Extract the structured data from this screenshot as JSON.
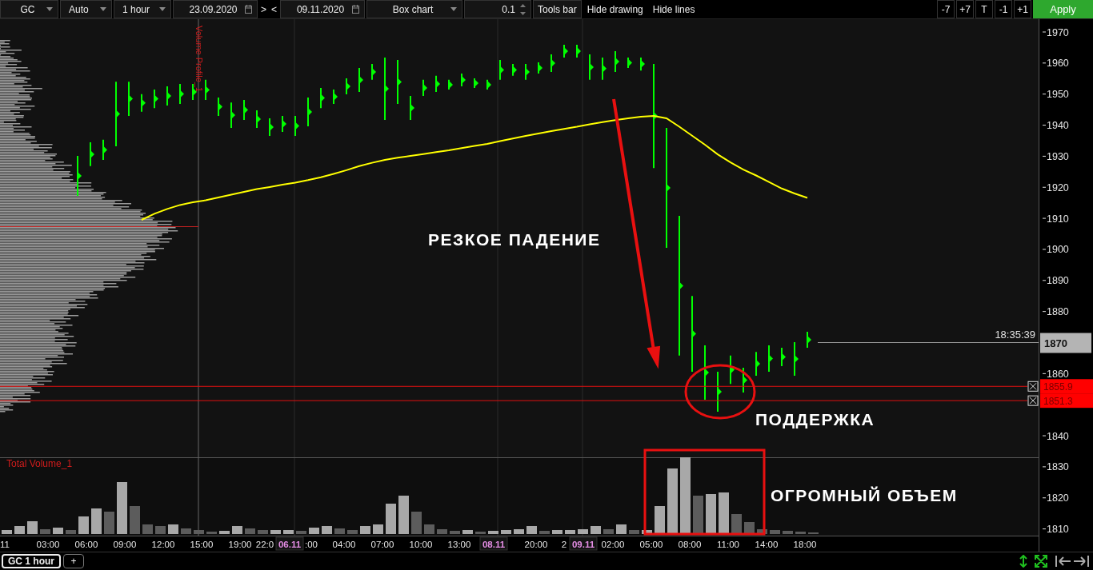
{
  "toolbar": {
    "symbol": "GC",
    "scale": "Auto",
    "timeframe": "1 hour",
    "date_from": "23.09.2020",
    "step_forward": ">",
    "step_back": "<",
    "date_to": "09.11.2020",
    "chart_type": "Box chart",
    "tick_size": "0.1",
    "buttons": [
      "Tools bar",
      "Hide drawing",
      "Hide lines"
    ],
    "shift_buttons": [
      "-7",
      "+7",
      "T",
      "-1",
      "+1"
    ],
    "apply": "Apply"
  },
  "price_pane": {
    "indicator": "Volume Profile_1",
    "price_axis": [
      "1970",
      "1960",
      "1950",
      "1940",
      "1930",
      "1920",
      "1910",
      "1900",
      "1890",
      "1880",
      "1860",
      "1840",
      "1830",
      "1820",
      "1810"
    ],
    "price_markers": [
      {
        "kind": "last",
        "label": "1870",
        "time": "18:35:39"
      },
      {
        "kind": "level",
        "label": "1855.9"
      },
      {
        "kind": "level",
        "label": "1851.3"
      }
    ]
  },
  "volume_pane": {
    "indicator": "Total Volume_1"
  },
  "time_axis": [
    {
      "label": "11",
      "kind": "time"
    },
    {
      "label": "03:00",
      "kind": "time"
    },
    {
      "label": "06:00",
      "kind": "time"
    },
    {
      "label": "09:00",
      "kind": "time"
    },
    {
      "label": "12:00",
      "kind": "time"
    },
    {
      "label": "15:00",
      "kind": "time"
    },
    {
      "label": "19:00",
      "kind": "time"
    },
    {
      "label": "22:0",
      "kind": "time"
    },
    {
      "label": "06.11",
      "kind": "date"
    },
    {
      "label": ":00",
      "kind": "time"
    },
    {
      "label": "04:00",
      "kind": "time"
    },
    {
      "label": "07:00",
      "kind": "time"
    },
    {
      "label": "10:00",
      "kind": "time"
    },
    {
      "label": "13:00",
      "kind": "time"
    },
    {
      "label": "08.11",
      "kind": "date"
    },
    {
      "label": "20:00",
      "kind": "time"
    },
    {
      "label": "2",
      "kind": "time"
    },
    {
      "label": "09.11",
      "kind": "date"
    },
    {
      "label": "02:00",
      "kind": "time"
    },
    {
      "label": "05:00",
      "kind": "time"
    },
    {
      "label": "08:00",
      "kind": "time"
    },
    {
      "label": "11:00",
      "kind": "time"
    },
    {
      "label": "14:00",
      "kind": "time"
    },
    {
      "label": "18:00",
      "kind": "time"
    }
  ],
  "annotations": [
    {
      "kind": "fall",
      "text": "РЕЗКОЕ ПАДЕНИЕ"
    },
    {
      "kind": "support",
      "text": "ПОДДЕРЖКА"
    },
    {
      "kind": "volume",
      "text": "ОГРОМНЫЙ ОБЪЕМ"
    }
  ],
  "tabs": [
    {
      "label": "GC 1 hour",
      "selected": true
    }
  ],
  "add_tab": "+"
}
